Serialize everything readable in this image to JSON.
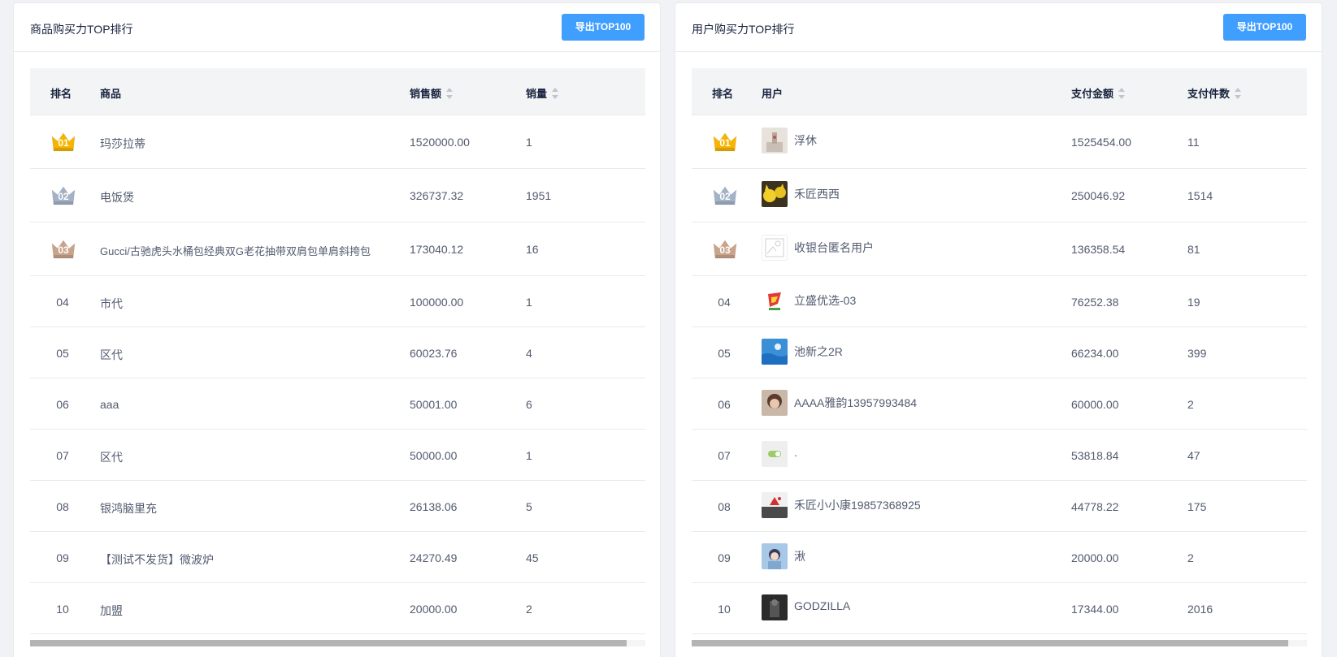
{
  "left": {
    "title": "商品购买力TOP排行",
    "export_label": "导出TOP100",
    "headers": {
      "rank": "排名",
      "product": "商品",
      "sales": "销售额",
      "qty": "销量"
    },
    "rows": [
      {
        "rank": "01",
        "name": "玛莎拉蒂",
        "sales": "1520000.00",
        "qty": "1"
      },
      {
        "rank": "02",
        "name": "电饭煲",
        "sales": "326737.32",
        "qty": "1951"
      },
      {
        "rank": "03",
        "name": "Gucci/古驰虎头水桶包经典双G老花抽带双肩包单肩斜挎包",
        "sales": "173040.12",
        "qty": "16"
      },
      {
        "rank": "04",
        "name": "市代",
        "sales": "100000.00",
        "qty": "1"
      },
      {
        "rank": "05",
        "name": "区代",
        "sales": "60023.76",
        "qty": "4"
      },
      {
        "rank": "06",
        "name": "aaa",
        "sales": "50001.00",
        "qty": "6"
      },
      {
        "rank": "07",
        "name": "区代",
        "sales": "50000.00",
        "qty": "1"
      },
      {
        "rank": "08",
        "name": "银鸿脑里充",
        "sales": "26138.06",
        "qty": "5"
      },
      {
        "rank": "09",
        "name": "【测试不发货】微波炉",
        "sales": "24270.49",
        "qty": "45"
      },
      {
        "rank": "10",
        "name": "加盟",
        "sales": "20000.00",
        "qty": "2"
      }
    ]
  },
  "right": {
    "title": "用户购买力TOP排行",
    "export_label": "导出TOP100",
    "headers": {
      "rank": "排名",
      "user": "用户",
      "amount": "支付金额",
      "count": "支付件数"
    },
    "rows": [
      {
        "rank": "01",
        "name": "浮休",
        "amount": "1525454.00",
        "count": "11",
        "avatar": "building"
      },
      {
        "rank": "02",
        "name": "禾匠西西",
        "amount": "250046.92",
        "count": "1514",
        "avatar": "pikachu"
      },
      {
        "rank": "03",
        "name": "收银台匿名用户",
        "amount": "136358.54",
        "count": "81",
        "avatar": "placeholder"
      },
      {
        "rank": "04",
        "name": "立盛优选-03",
        "amount": "76252.38",
        "count": "19",
        "avatar": "logo"
      },
      {
        "rank": "05",
        "name": "池新之2R",
        "amount": "66234.00",
        "count": "399",
        "avatar": "sea"
      },
      {
        "rank": "06",
        "name": "AAAA雅韵13957993484",
        "amount": "60000.00",
        "count": "2",
        "avatar": "portrait"
      },
      {
        "rank": "07",
        "name": ".",
        "amount": "53818.84",
        "count": "47",
        "avatar": "toggle"
      },
      {
        "rank": "08",
        "name": "禾匠小小康19857368925",
        "amount": "44778.22",
        "count": "175",
        "avatar": "christmas"
      },
      {
        "rank": "09",
        "name": "湫",
        "amount": "20000.00",
        "count": "2",
        "avatar": "girl"
      },
      {
        "rank": "10",
        "name": "GODZILLA",
        "amount": "17344.00",
        "count": "2016",
        "avatar": "dark"
      }
    ]
  },
  "colors": {
    "primary": "#409eff",
    "gold": "#f7b500",
    "silver": "#a3b2c6",
    "bronze": "#c9a38a"
  },
  "scroll_fraction": 0.97
}
